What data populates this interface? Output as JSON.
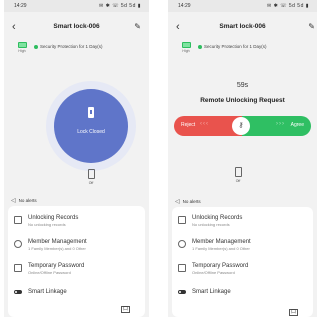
{
  "left": {
    "status": {
      "time": "14:29",
      "icons": "✉ ✱ ☏ 5d 5d ▮"
    },
    "header": {
      "title": "Smart lock-006",
      "back": "‹",
      "edit": "✎"
    },
    "battery_label": "High",
    "security_text": "Security Protection for 1 Day(s)",
    "lock_state": "Lock Closed",
    "switch_label": "Off",
    "alerts": "No alerts",
    "menu": [
      {
        "title": "Unlocking Records",
        "subtitle": "No unlocking records"
      },
      {
        "title": "Member Management",
        "subtitle": "1 Family Member(s) and 0 Other"
      },
      {
        "title": "Temporary Password",
        "subtitle": "Online/Offline Password"
      },
      {
        "title": "Smart Linkage",
        "subtitle": ""
      }
    ],
    "bottom_glyph": "口"
  },
  "right": {
    "status": {
      "time": "14:29",
      "icons": "✉ ✱ ☏ 5d 5d ▮"
    },
    "header": {
      "title": "Smart lock-006",
      "back": "‹",
      "edit": "✎"
    },
    "battery_label": "High",
    "security_text": "Security Protection for 1 Day(s)",
    "countdown": "59s",
    "request_title": "Remote Unlocking Request",
    "reject_label": "Reject",
    "agree_label": "Agree",
    "knob_icon": "⚷",
    "switch_label": "Off",
    "alerts": "No alerts",
    "menu": [
      {
        "title": "Unlocking Records",
        "subtitle": "No unlocking records"
      },
      {
        "title": "Member Management",
        "subtitle": "1 Family Member(s) and 0 Other"
      },
      {
        "title": "Temporary Password",
        "subtitle": "Online/Offline Password"
      },
      {
        "title": "Smart Linkage",
        "subtitle": ""
      }
    ],
    "bottom_glyph": "口"
  },
  "colors": {
    "accent": "#5f75c9",
    "reject": "#e9534d",
    "agree": "#2fbf63",
    "battery": "#2ebd5f"
  }
}
